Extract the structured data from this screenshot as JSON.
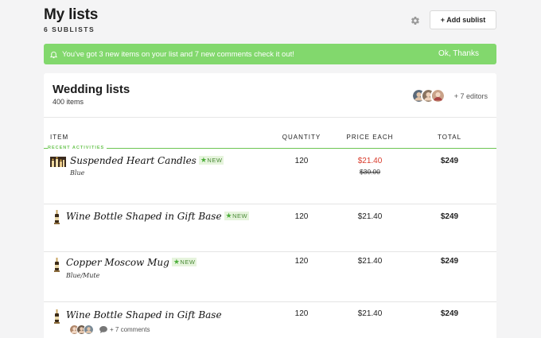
{
  "header": {
    "title": "My lists",
    "subtitle": "6 SUBLISTS",
    "add_label": "+ Add sublist"
  },
  "notice": {
    "message": "You've got 3 new items on your list and 7 new comments check it out!",
    "action": "Ok, Thanks",
    "color": "#82d86d"
  },
  "card": {
    "title": "Wedding lists",
    "count": "400 items",
    "editors_label": "+ 7 editors",
    "columns": [
      "ITEM",
      "QUANTITY",
      "PRICE EACH",
      "TOTAL"
    ],
    "recent_label": "RECENT ACTIVITIES",
    "items": [
      {
        "name": "Suspended Heart Candles",
        "badge": "NEW",
        "variant": "Blue",
        "quantity": "120",
        "price": "$21.40",
        "old_price": "$30.00",
        "total": "$249",
        "thumb": "candles-thumbnail"
      },
      {
        "name": "Wine Bottle Shaped in Gift Base",
        "badge": "NEW",
        "variant": "",
        "quantity": "120",
        "price": "$21.40",
        "total": "$249",
        "thumb": "bottle-thumbnail"
      },
      {
        "name": "Copper Moscow Mug",
        "badge": "NEW",
        "variant": "Blue/Mute",
        "quantity": "120",
        "price": "$21.40",
        "total": "$249",
        "thumb": "bottle-thumbnail"
      },
      {
        "name": "Wine Bottle Shaped in Gift Base",
        "badge": "",
        "variant": "",
        "quantity": "120",
        "price": "$21.40",
        "total": "$249",
        "thumb": "bottle-thumbnail",
        "comments": "+ 7 comments"
      }
    ]
  },
  "colors": {
    "accent": "#82d86d",
    "sale": "#d93a2b",
    "badge_text": "#4a8a36"
  }
}
